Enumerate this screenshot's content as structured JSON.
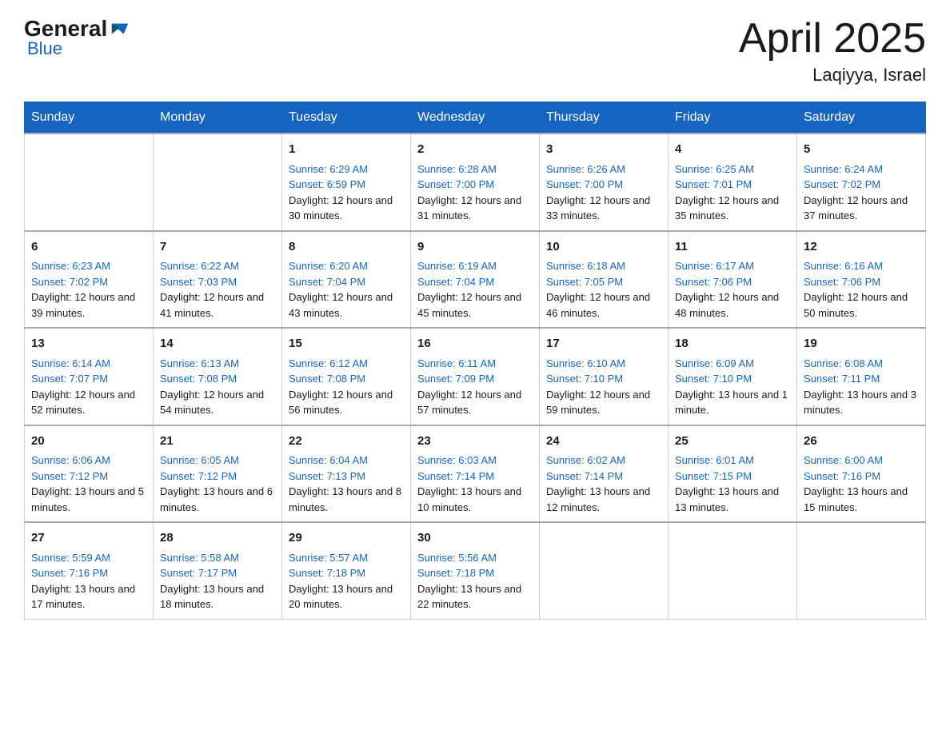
{
  "header": {
    "logo_general": "General",
    "logo_blue": "Blue",
    "month_title": "April 2025",
    "location": "Laqiyya, Israel"
  },
  "days_of_week": [
    "Sunday",
    "Monday",
    "Tuesday",
    "Wednesday",
    "Thursday",
    "Friday",
    "Saturday"
  ],
  "weeks": [
    [
      {
        "day": "",
        "sunrise": "",
        "sunset": "",
        "daylight": ""
      },
      {
        "day": "",
        "sunrise": "",
        "sunset": "",
        "daylight": ""
      },
      {
        "day": "1",
        "sunrise": "Sunrise: 6:29 AM",
        "sunset": "Sunset: 6:59 PM",
        "daylight": "Daylight: 12 hours and 30 minutes."
      },
      {
        "day": "2",
        "sunrise": "Sunrise: 6:28 AM",
        "sunset": "Sunset: 7:00 PM",
        "daylight": "Daylight: 12 hours and 31 minutes."
      },
      {
        "day": "3",
        "sunrise": "Sunrise: 6:26 AM",
        "sunset": "Sunset: 7:00 PM",
        "daylight": "Daylight: 12 hours and 33 minutes."
      },
      {
        "day": "4",
        "sunrise": "Sunrise: 6:25 AM",
        "sunset": "Sunset: 7:01 PM",
        "daylight": "Daylight: 12 hours and 35 minutes."
      },
      {
        "day": "5",
        "sunrise": "Sunrise: 6:24 AM",
        "sunset": "Sunset: 7:02 PM",
        "daylight": "Daylight: 12 hours and 37 minutes."
      }
    ],
    [
      {
        "day": "6",
        "sunrise": "Sunrise: 6:23 AM",
        "sunset": "Sunset: 7:02 PM",
        "daylight": "Daylight: 12 hours and 39 minutes."
      },
      {
        "day": "7",
        "sunrise": "Sunrise: 6:22 AM",
        "sunset": "Sunset: 7:03 PM",
        "daylight": "Daylight: 12 hours and 41 minutes."
      },
      {
        "day": "8",
        "sunrise": "Sunrise: 6:20 AM",
        "sunset": "Sunset: 7:04 PM",
        "daylight": "Daylight: 12 hours and 43 minutes."
      },
      {
        "day": "9",
        "sunrise": "Sunrise: 6:19 AM",
        "sunset": "Sunset: 7:04 PM",
        "daylight": "Daylight: 12 hours and 45 minutes."
      },
      {
        "day": "10",
        "sunrise": "Sunrise: 6:18 AM",
        "sunset": "Sunset: 7:05 PM",
        "daylight": "Daylight: 12 hours and 46 minutes."
      },
      {
        "day": "11",
        "sunrise": "Sunrise: 6:17 AM",
        "sunset": "Sunset: 7:06 PM",
        "daylight": "Daylight: 12 hours and 48 minutes."
      },
      {
        "day": "12",
        "sunrise": "Sunrise: 6:16 AM",
        "sunset": "Sunset: 7:06 PM",
        "daylight": "Daylight: 12 hours and 50 minutes."
      }
    ],
    [
      {
        "day": "13",
        "sunrise": "Sunrise: 6:14 AM",
        "sunset": "Sunset: 7:07 PM",
        "daylight": "Daylight: 12 hours and 52 minutes."
      },
      {
        "day": "14",
        "sunrise": "Sunrise: 6:13 AM",
        "sunset": "Sunset: 7:08 PM",
        "daylight": "Daylight: 12 hours and 54 minutes."
      },
      {
        "day": "15",
        "sunrise": "Sunrise: 6:12 AM",
        "sunset": "Sunset: 7:08 PM",
        "daylight": "Daylight: 12 hours and 56 minutes."
      },
      {
        "day": "16",
        "sunrise": "Sunrise: 6:11 AM",
        "sunset": "Sunset: 7:09 PM",
        "daylight": "Daylight: 12 hours and 57 minutes."
      },
      {
        "day": "17",
        "sunrise": "Sunrise: 6:10 AM",
        "sunset": "Sunset: 7:10 PM",
        "daylight": "Daylight: 12 hours and 59 minutes."
      },
      {
        "day": "18",
        "sunrise": "Sunrise: 6:09 AM",
        "sunset": "Sunset: 7:10 PM",
        "daylight": "Daylight: 13 hours and 1 minute."
      },
      {
        "day": "19",
        "sunrise": "Sunrise: 6:08 AM",
        "sunset": "Sunset: 7:11 PM",
        "daylight": "Daylight: 13 hours and 3 minutes."
      }
    ],
    [
      {
        "day": "20",
        "sunrise": "Sunrise: 6:06 AM",
        "sunset": "Sunset: 7:12 PM",
        "daylight": "Daylight: 13 hours and 5 minutes."
      },
      {
        "day": "21",
        "sunrise": "Sunrise: 6:05 AM",
        "sunset": "Sunset: 7:12 PM",
        "daylight": "Daylight: 13 hours and 6 minutes."
      },
      {
        "day": "22",
        "sunrise": "Sunrise: 6:04 AM",
        "sunset": "Sunset: 7:13 PM",
        "daylight": "Daylight: 13 hours and 8 minutes."
      },
      {
        "day": "23",
        "sunrise": "Sunrise: 6:03 AM",
        "sunset": "Sunset: 7:14 PM",
        "daylight": "Daylight: 13 hours and 10 minutes."
      },
      {
        "day": "24",
        "sunrise": "Sunrise: 6:02 AM",
        "sunset": "Sunset: 7:14 PM",
        "daylight": "Daylight: 13 hours and 12 minutes."
      },
      {
        "day": "25",
        "sunrise": "Sunrise: 6:01 AM",
        "sunset": "Sunset: 7:15 PM",
        "daylight": "Daylight: 13 hours and 13 minutes."
      },
      {
        "day": "26",
        "sunrise": "Sunrise: 6:00 AM",
        "sunset": "Sunset: 7:16 PM",
        "daylight": "Daylight: 13 hours and 15 minutes."
      }
    ],
    [
      {
        "day": "27",
        "sunrise": "Sunrise: 5:59 AM",
        "sunset": "Sunset: 7:16 PM",
        "daylight": "Daylight: 13 hours and 17 minutes."
      },
      {
        "day": "28",
        "sunrise": "Sunrise: 5:58 AM",
        "sunset": "Sunset: 7:17 PM",
        "daylight": "Daylight: 13 hours and 18 minutes."
      },
      {
        "day": "29",
        "sunrise": "Sunrise: 5:57 AM",
        "sunset": "Sunset: 7:18 PM",
        "daylight": "Daylight: 13 hours and 20 minutes."
      },
      {
        "day": "30",
        "sunrise": "Sunrise: 5:56 AM",
        "sunset": "Sunset: 7:18 PM",
        "daylight": "Daylight: 13 hours and 22 minutes."
      },
      {
        "day": "",
        "sunrise": "",
        "sunset": "",
        "daylight": ""
      },
      {
        "day": "",
        "sunrise": "",
        "sunset": "",
        "daylight": ""
      },
      {
        "day": "",
        "sunrise": "",
        "sunset": "",
        "daylight": ""
      }
    ]
  ]
}
